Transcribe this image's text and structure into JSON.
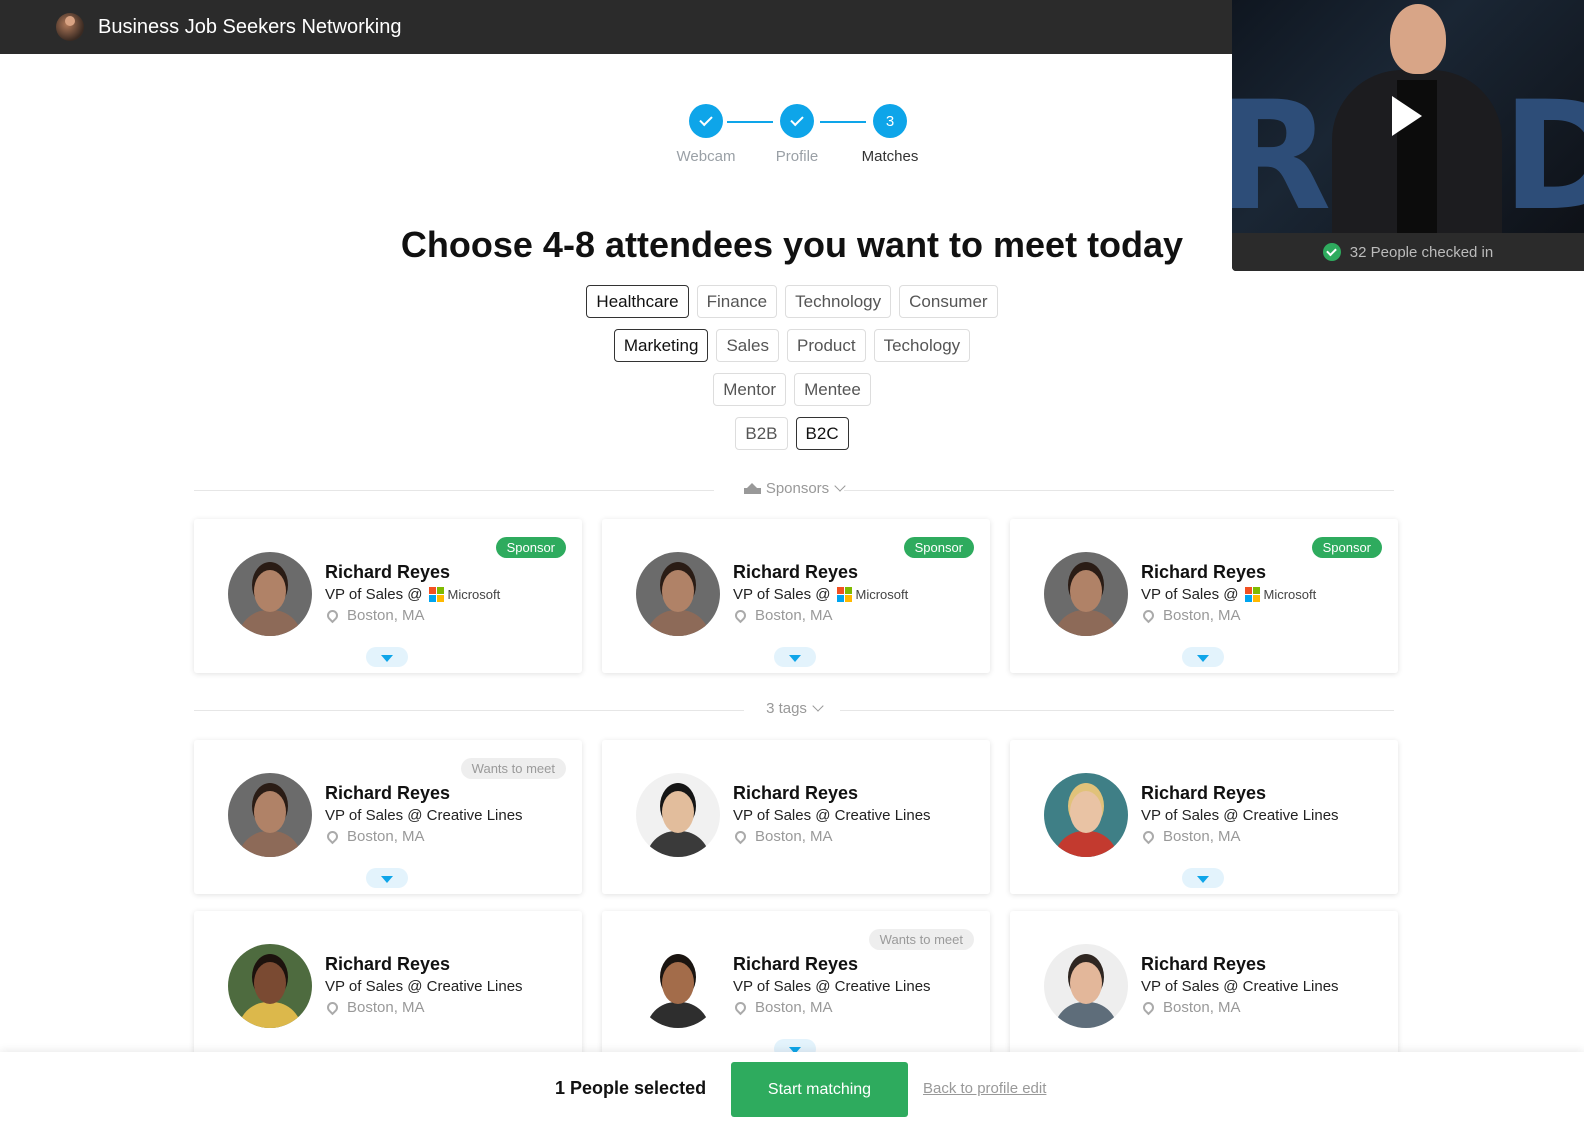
{
  "app": {
    "title": "Business Job Seekers Networking"
  },
  "video": {
    "status_text": "32 People checked in"
  },
  "stepper": {
    "steps": [
      {
        "label": "Webcam",
        "state": "done"
      },
      {
        "label": "Profile",
        "state": "done"
      },
      {
        "label": "Matches",
        "state": "active",
        "number": "3"
      }
    ]
  },
  "heading": "Choose 4-8 attendees you want to meet today",
  "tag_rows": [
    [
      {
        "label": "Healthcare",
        "selected": true
      },
      {
        "label": "Finance",
        "selected": false
      },
      {
        "label": "Technology",
        "selected": false
      },
      {
        "label": "Consumer",
        "selected": false
      }
    ],
    [
      {
        "label": "Marketing",
        "selected": true
      },
      {
        "label": "Sales",
        "selected": false
      },
      {
        "label": "Product",
        "selected": false
      },
      {
        "label": "Techology",
        "selected": false
      }
    ],
    [
      {
        "label": "Mentor",
        "selected": false
      },
      {
        "label": "Mentee",
        "selected": false
      }
    ],
    [
      {
        "label": "B2B",
        "selected": false
      },
      {
        "label": "B2C",
        "selected": true
      }
    ]
  ],
  "sections": {
    "sponsors_label": "Sponsors",
    "tags_label": "3 tags"
  },
  "sponsor_cards": [
    {
      "name": "Richard Reyes",
      "role": "VP of Sales @",
      "company": "Microsoft",
      "location": "Boston, MA",
      "badge": "Sponsor",
      "avatar": "man-long-hair"
    },
    {
      "name": "Richard Reyes",
      "role": "VP of Sales @",
      "company": "Microsoft",
      "location": "Boston, MA",
      "badge": "Sponsor",
      "avatar": "man-long-hair"
    },
    {
      "name": "Richard Reyes",
      "role": "VP of Sales @",
      "company": "Microsoft",
      "location": "Boston, MA",
      "badge": "Sponsor",
      "avatar": "man-long-hair"
    }
  ],
  "match_cards": [
    {
      "name": "Richard Reyes",
      "role": "VP of Sales @ Creative Lines",
      "location": "Boston, MA",
      "badge": "Wants to meet",
      "avatar": "man-long-hair",
      "expand": true
    },
    {
      "name": "Richard Reyes",
      "role": "VP of Sales @ Creative Lines",
      "location": "Boston, MA",
      "badge": "",
      "avatar": "asian-man",
      "expand": false
    },
    {
      "name": "Richard Reyes",
      "role": "VP of Sales @ Creative Lines",
      "location": "Boston, MA",
      "badge": "",
      "avatar": "woman-glasses",
      "expand": true
    },
    {
      "name": "Richard Reyes",
      "role": "VP of Sales @ Creative Lines",
      "location": "Boston, MA",
      "badge": "",
      "avatar": "woman-curly",
      "expand": false
    },
    {
      "name": "Richard Reyes",
      "role": "VP of Sales @ Creative Lines",
      "location": "Boston, MA",
      "badge": "Wants to meet",
      "avatar": "man-curly",
      "expand": true
    },
    {
      "name": "Richard Reyes",
      "role": "VP of Sales @ Creative Lines",
      "location": "Boston, MA",
      "badge": "",
      "avatar": "man-beard",
      "expand": false
    }
  ],
  "footer": {
    "selected_text": "1 People selected",
    "start_label": "Start matching",
    "back_label": "Back to profile edit"
  },
  "colors": {
    "accent": "#0ea5e9",
    "success": "#2eab5e",
    "topbar": "#2b2b2b"
  }
}
